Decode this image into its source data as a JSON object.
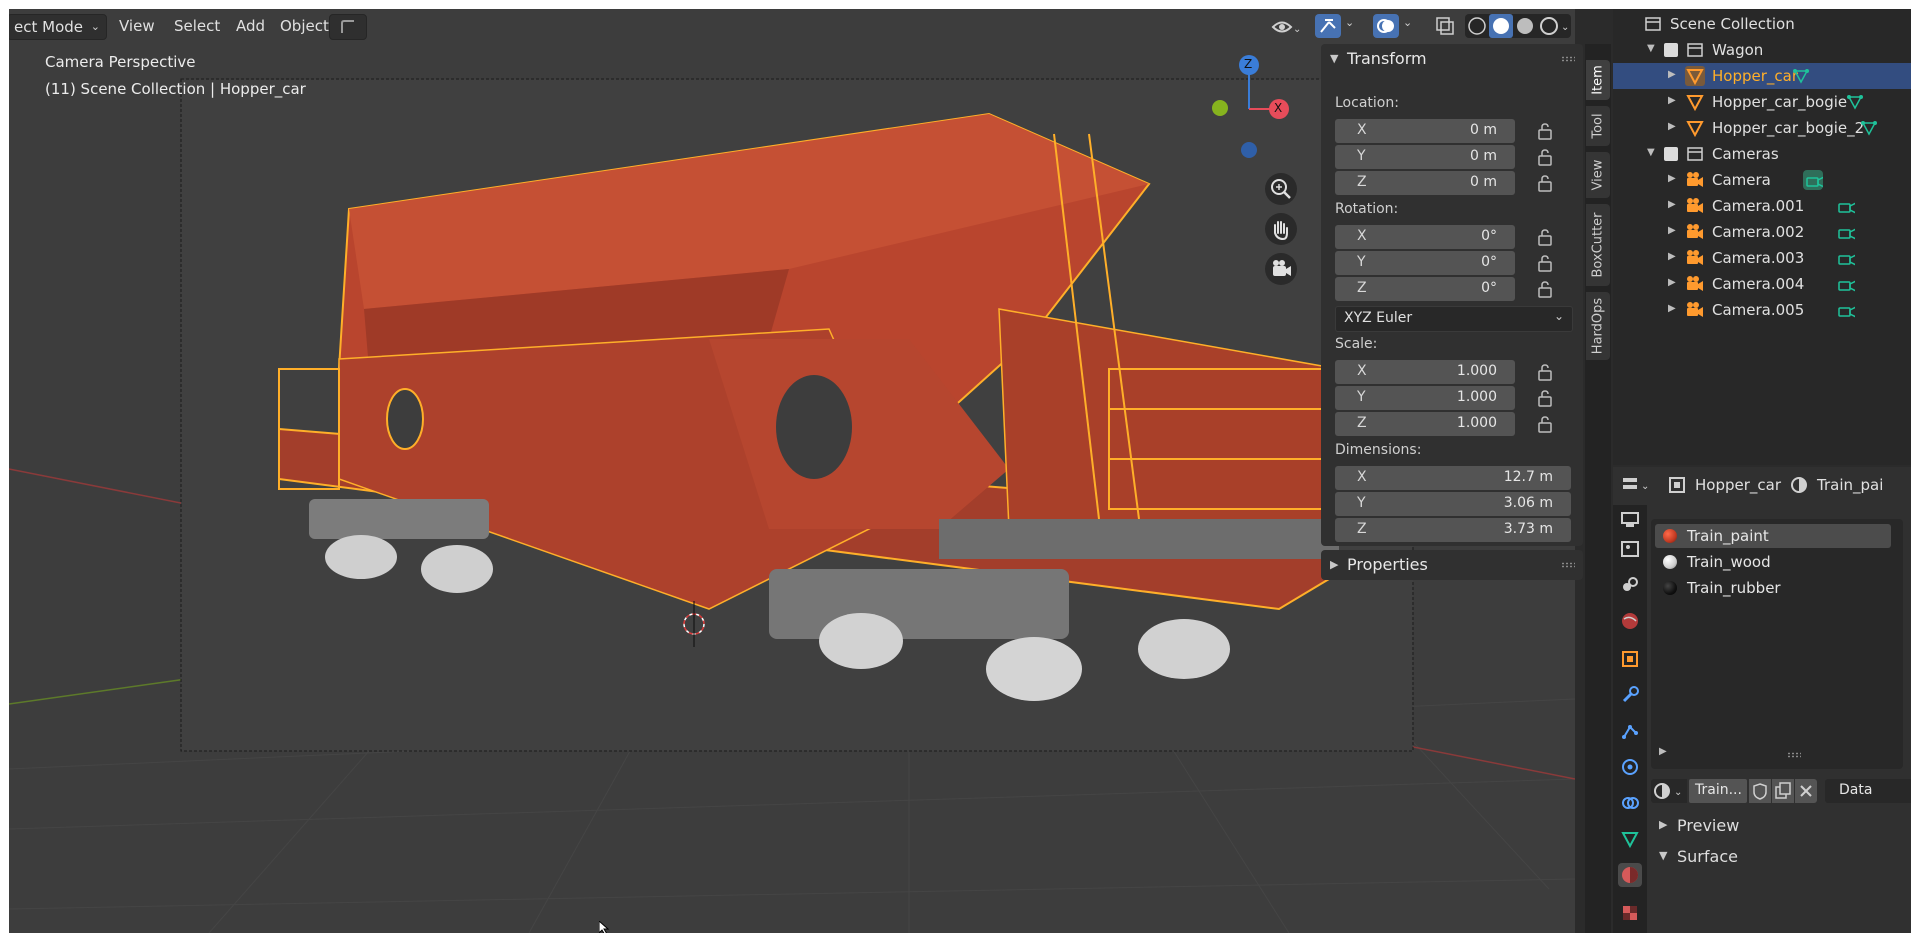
{
  "viewport": {
    "mode_label": "ect Mode",
    "menus": [
      "View",
      "Select",
      "Add",
      "Object"
    ],
    "overlay_title": "Camera Perspective",
    "overlay_subtitle": "(11) Scene Collection | Hopper_car",
    "gizmo": {
      "x_label": "X",
      "z_label": "Z"
    }
  },
  "npanel": {
    "transform_title": "Transform",
    "location_label": "Location:",
    "location": [
      {
        "axis": "X",
        "value": "0 m"
      },
      {
        "axis": "Y",
        "value": "0 m"
      },
      {
        "axis": "Z",
        "value": "0 m"
      }
    ],
    "rotation_label": "Rotation:",
    "rotation": [
      {
        "axis": "X",
        "value": "0°"
      },
      {
        "axis": "Y",
        "value": "0°"
      },
      {
        "axis": "Z",
        "value": "0°"
      }
    ],
    "rotation_mode": "XYZ Euler",
    "scale_label": "Scale:",
    "scale": [
      {
        "axis": "X",
        "value": "1.000"
      },
      {
        "axis": "Y",
        "value": "1.000"
      },
      {
        "axis": "Z",
        "value": "1.000"
      }
    ],
    "dimensions_label": "Dimensions:",
    "dimensions": [
      {
        "axis": "X",
        "value": "12.7 m"
      },
      {
        "axis": "Y",
        "value": "3.06 m"
      },
      {
        "axis": "Z",
        "value": "3.73 m"
      }
    ],
    "properties_title": "Properties",
    "tabs": [
      "Item",
      "Tool",
      "View",
      "BoxCutter",
      "HardOps"
    ]
  },
  "outliner": {
    "root": "Scene Collection",
    "wagon": "Wagon",
    "hopper_car": "Hopper_car",
    "bogie": "Hopper_car_bogie",
    "bogie2": "Hopper_car_bogie_2",
    "cameras": "Cameras",
    "camera_items": [
      "Camera",
      "Camera.001",
      "Camera.002",
      "Camera.003",
      "Camera.004",
      "Camera.005"
    ]
  },
  "properties": {
    "object_name": "Hopper_car",
    "material_name": "Train_pai",
    "slots": [
      {
        "name": "Train_paint",
        "color": "#c23a22"
      },
      {
        "name": "Train_wood",
        "color": "#cfcfcf"
      },
      {
        "name": "Train_rubber",
        "color": "#111111"
      }
    ],
    "material_field": "Train...",
    "data_label": "Data",
    "preview_label": "Preview",
    "surface_label": "Surface"
  },
  "colors": {
    "selection_orange": "#ffaf29",
    "wagon_red": "#b9452e",
    "selected_row": "#334d80",
    "axis_x": "#e74c5a",
    "axis_z": "#3a7dd8",
    "axis_y": "#86b31e"
  }
}
